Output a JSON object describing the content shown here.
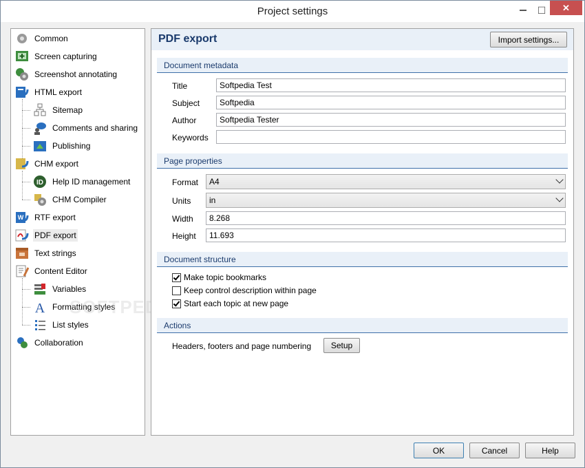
{
  "window": {
    "title": "Project settings",
    "min_icon": "minimize-icon",
    "max_icon": "maximize-icon",
    "close_icon": "close-icon",
    "max_glyph": "☐",
    "close_glyph": "✕"
  },
  "tree": {
    "items": [
      {
        "label": "Common",
        "icon": "gears-icon"
      },
      {
        "label": "Screen capturing",
        "icon": "screen-capture-icon"
      },
      {
        "label": "Screenshot annotating",
        "icon": "annotation-icon"
      },
      {
        "label": "HTML export",
        "icon": "html-export-icon"
      },
      {
        "label": "Sitemap",
        "icon": "sitemap-icon"
      },
      {
        "label": "Comments and sharing",
        "icon": "comments-icon"
      },
      {
        "label": "Publishing",
        "icon": "publishing-icon"
      },
      {
        "label": "CHM export",
        "icon": "chm-export-icon"
      },
      {
        "label": "Help ID management",
        "icon": "help-id-icon"
      },
      {
        "label": "CHM Compiler",
        "icon": "chm-compiler-icon"
      },
      {
        "label": "RTF export",
        "icon": "rtf-export-icon"
      },
      {
        "label": "PDF export",
        "icon": "pdf-export-icon"
      },
      {
        "label": "Text strings",
        "icon": "text-strings-icon"
      },
      {
        "label": "Content Editor",
        "icon": "content-editor-icon"
      },
      {
        "label": "Variables",
        "icon": "variables-icon"
      },
      {
        "label": "Formatting styles",
        "icon": "formatting-styles-icon"
      },
      {
        "label": "List styles",
        "icon": "list-styles-icon"
      },
      {
        "label": "Collaboration",
        "icon": "collaboration-icon"
      }
    ]
  },
  "panel": {
    "title": "PDF export",
    "import_button": "Import settings...",
    "metadata": {
      "heading": "Document metadata",
      "title_label": "Title",
      "title_value": "Softpedia Test",
      "subject_label": "Subject",
      "subject_value": "Softpedia",
      "author_label": "Author",
      "author_value": "Softpedia Tester",
      "keywords_label": "Keywords",
      "keywords_value": ""
    },
    "page": {
      "heading": "Page properties",
      "format_label": "Format",
      "format_value": "A4",
      "units_label": "Units",
      "units_value": "in",
      "width_label": "Width",
      "width_value": "8.268",
      "height_label": "Height",
      "height_value": "11.693"
    },
    "structure": {
      "heading": "Document structure",
      "opt1": "Make topic bookmarks",
      "opt1_checked": true,
      "opt2": "Keep control description within page",
      "opt2_checked": false,
      "opt3": "Start each topic at new page",
      "opt3_checked": true
    },
    "actions": {
      "heading": "Actions",
      "label": "Headers, footers and page numbering",
      "setup_button": "Setup"
    }
  },
  "footer": {
    "ok": "OK",
    "cancel": "Cancel",
    "help": "Help"
  },
  "watermark": "SOFTPEDIA"
}
